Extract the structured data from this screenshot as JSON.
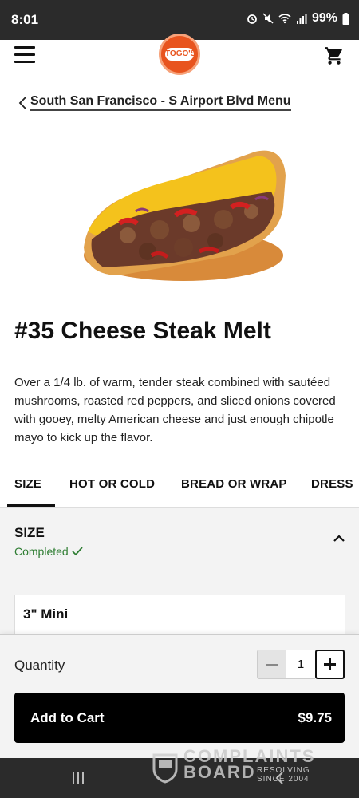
{
  "status_bar": {
    "time": "8:01",
    "battery": "99%",
    "icons": [
      "alarm-icon",
      "mute-icon",
      "wifi-icon",
      "signal-icon",
      "battery-icon"
    ]
  },
  "header": {
    "menu_icon": "hamburger-menu-icon",
    "logo_text": "TOGO'S",
    "cart_icon": "shopping-cart-icon"
  },
  "breadcrumb": {
    "back_label": "South San Francisco - S Airport Blvd Menu"
  },
  "product": {
    "title": "#35 Cheese Steak Melt",
    "description": "Over a 1/4 lb. of warm, tender steak combined with sautéed mushrooms, roasted red peppers, and sliced onions covered with gooey, melty American cheese and just enough chipotle mayo to kick up the flavor."
  },
  "tabs": [
    {
      "label": "SIZE",
      "active": true
    },
    {
      "label": "HOT OR COLD",
      "active": false
    },
    {
      "label": "BREAD OR WRAP",
      "active": false
    },
    {
      "label": "DRESS",
      "active": false
    }
  ],
  "section": {
    "title": "SIZE",
    "status": "Completed"
  },
  "options": [
    {
      "label": "3\" Mini"
    }
  ],
  "quantity": {
    "label": "Quantity",
    "value": "1"
  },
  "add_to_cart": {
    "label": "Add to Cart",
    "price": "$9.75"
  },
  "watermark": {
    "line1": "COMPLAINTS",
    "line2": "BOARD",
    "tagline": "RESOLVING SINCE 2004"
  },
  "colors": {
    "accent": "#000000",
    "brand": "#e8541e",
    "completed": "#2e7d32",
    "panel_bg": "#f3f3f3"
  }
}
